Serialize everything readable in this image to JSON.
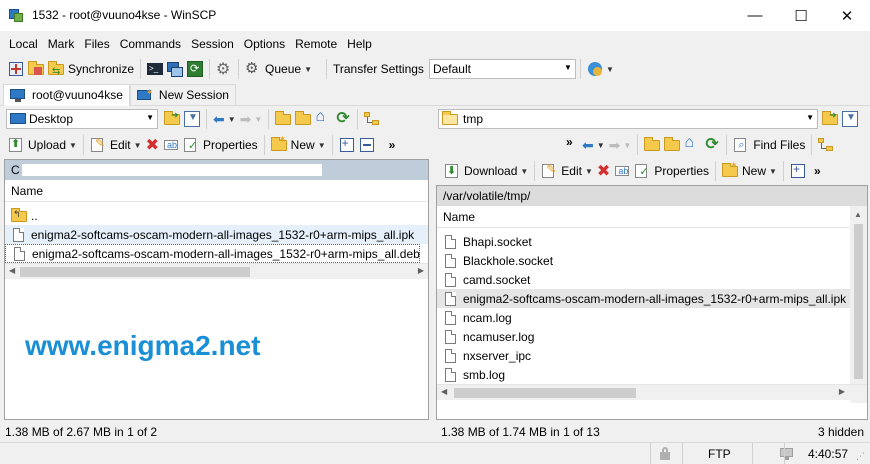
{
  "window": {
    "title": "1532 - root@vuuno4kse - WinSCP",
    "minimize_glyph": "—",
    "maximize_glyph": "☐",
    "close_glyph": "✕"
  },
  "menu": [
    "Local",
    "Mark",
    "Files",
    "Commands",
    "Session",
    "Options",
    "Remote",
    "Help"
  ],
  "toolbar": {
    "synchronize_label": "Synchronize",
    "queue_label": "Queue",
    "transfer_settings_label": "Transfer Settings",
    "transfer_settings_value": "Default"
  },
  "tabs": [
    {
      "label": "root@vuuno4kse",
      "active": true
    },
    {
      "label": "New Session",
      "active": false
    }
  ],
  "left": {
    "location": "Desktop",
    "upload_label": "Upload",
    "edit_label": "Edit",
    "properties_label": "Properties",
    "new_label": "New",
    "path_prefix": "C",
    "column_name": "Name",
    "parent_label": "..",
    "files": [
      "enigma2-softcams-oscam-modern-all-images_1532-r0+arm-mips_all.ipk",
      "enigma2-softcams-oscam-modern-all-images_1532-r0+arm-mips_all.deb"
    ],
    "status": "1.38 MB of 2.67 MB in 1 of 2"
  },
  "right": {
    "location": "tmp",
    "download_label": "Download",
    "edit_label": "Edit",
    "properties_label": "Properties",
    "new_label": "New",
    "find_files_label": "Find Files",
    "path": "/var/volatile/tmp/",
    "column_name": "Name",
    "files": [
      "Bhapi.socket",
      "Blackhole.socket",
      "camd.socket",
      "enigma2-softcams-oscam-modern-all-images_1532-r0+arm-mips_all.ipk",
      "ncam.log",
      "ncamuser.log",
      "nxserver_ipc",
      "smb.log"
    ],
    "status": "1.38 MB of 1.74 MB in 1 of 13",
    "hidden": "3 hidden"
  },
  "watermark": "www.enigma2.net",
  "bottom": {
    "protocol": "FTP",
    "time": "4:40:57"
  },
  "colors": {
    "accent": "#1a8fd6",
    "path_title_bg": "#bfcddb",
    "selection": "#e5f0fb"
  }
}
